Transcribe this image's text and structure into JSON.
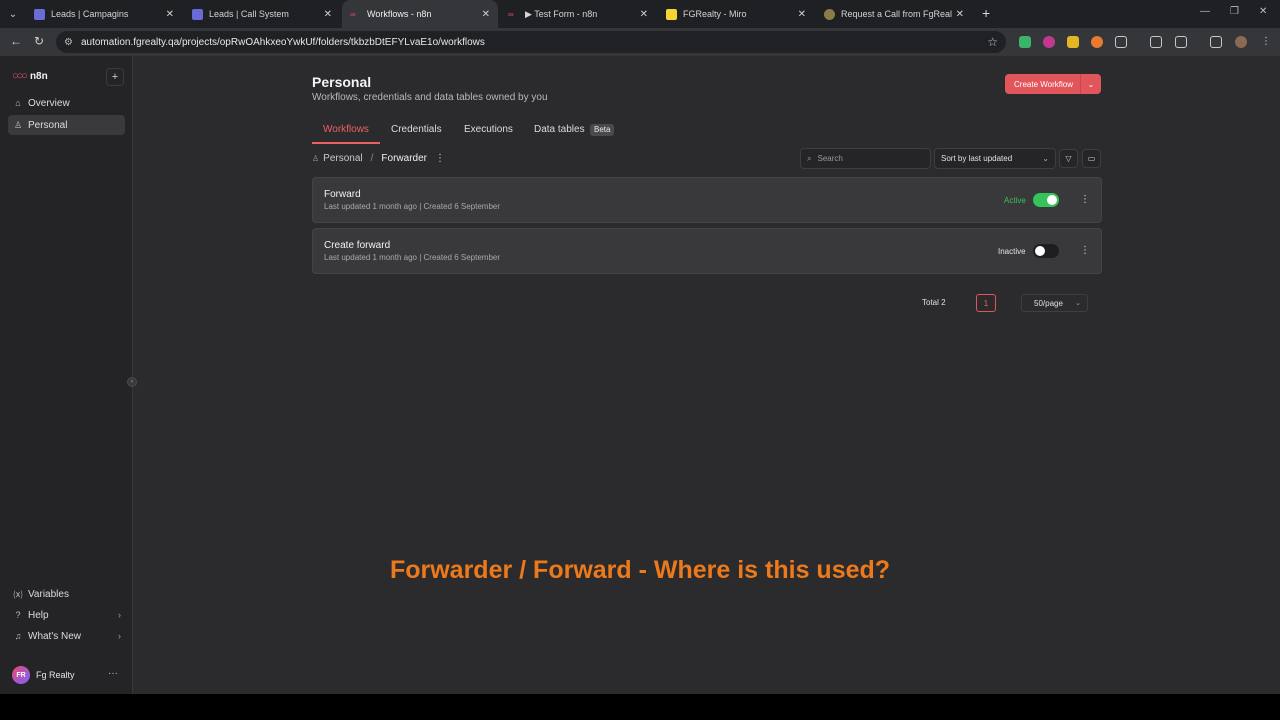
{
  "browser": {
    "tabs": [
      {
        "title": "Leads | Campagins",
        "active": false
      },
      {
        "title": "Leads | Call System",
        "active": false
      },
      {
        "title": "Workflows - n8n",
        "active": true
      },
      {
        "title": "▶ Test Form - n8n",
        "active": false
      },
      {
        "title": "FGRealty - Miro",
        "active": false
      },
      {
        "title": "Request a Call from FgRealty A",
        "active": false
      }
    ],
    "url": "automation.fgrealty.qa/projects/opRwOAhkxeoYwkUf/folders/tkbzbDtEFYLvaE1o/workflows"
  },
  "sidebar": {
    "brand": "n8n",
    "items": [
      {
        "label": "Overview",
        "icon": "home-icon"
      },
      {
        "label": "Personal",
        "icon": "user-icon"
      }
    ],
    "bottom_items": [
      {
        "label": "Variables",
        "icon": "variables-icon"
      },
      {
        "label": "Help",
        "icon": "help-icon"
      },
      {
        "label": "What's New",
        "icon": "bell-icon"
      }
    ],
    "user": {
      "initials": "FR",
      "name": "Fg Realty"
    }
  },
  "header": {
    "title": "Personal",
    "subtitle": "Workflows, credentials and data tables owned by you",
    "create_label": "Create Workflow"
  },
  "nav_tabs": [
    {
      "label": "Workflows",
      "active": true
    },
    {
      "label": "Credentials",
      "active": false
    },
    {
      "label": "Executions",
      "active": false
    },
    {
      "label": "Data tables",
      "active": false
    }
  ],
  "beta_badge": "Beta",
  "breadcrumb": {
    "root": "Personal",
    "current": "Forwarder"
  },
  "search": {
    "placeholder": "Search"
  },
  "sort": {
    "selected": "Sort by last updated"
  },
  "workflows": [
    {
      "name": "Forward",
      "updated": "Last updated 1 month ago",
      "created": "Created 6 September",
      "status": "Active",
      "active": true
    },
    {
      "name": "Create forward",
      "updated": "Last updated 1 month ago",
      "created": "Created 6 September",
      "status": "Inactive",
      "active": false
    }
  ],
  "pagination": {
    "total": "Total 2",
    "current_page": "1",
    "per_page": "50/page"
  },
  "overlay_caption": "Forwarder / Forward - Where is this used?",
  "colors": {
    "accent": "#ea6161",
    "active_green": "#37c35b",
    "overlay": "#ec7a1c"
  }
}
